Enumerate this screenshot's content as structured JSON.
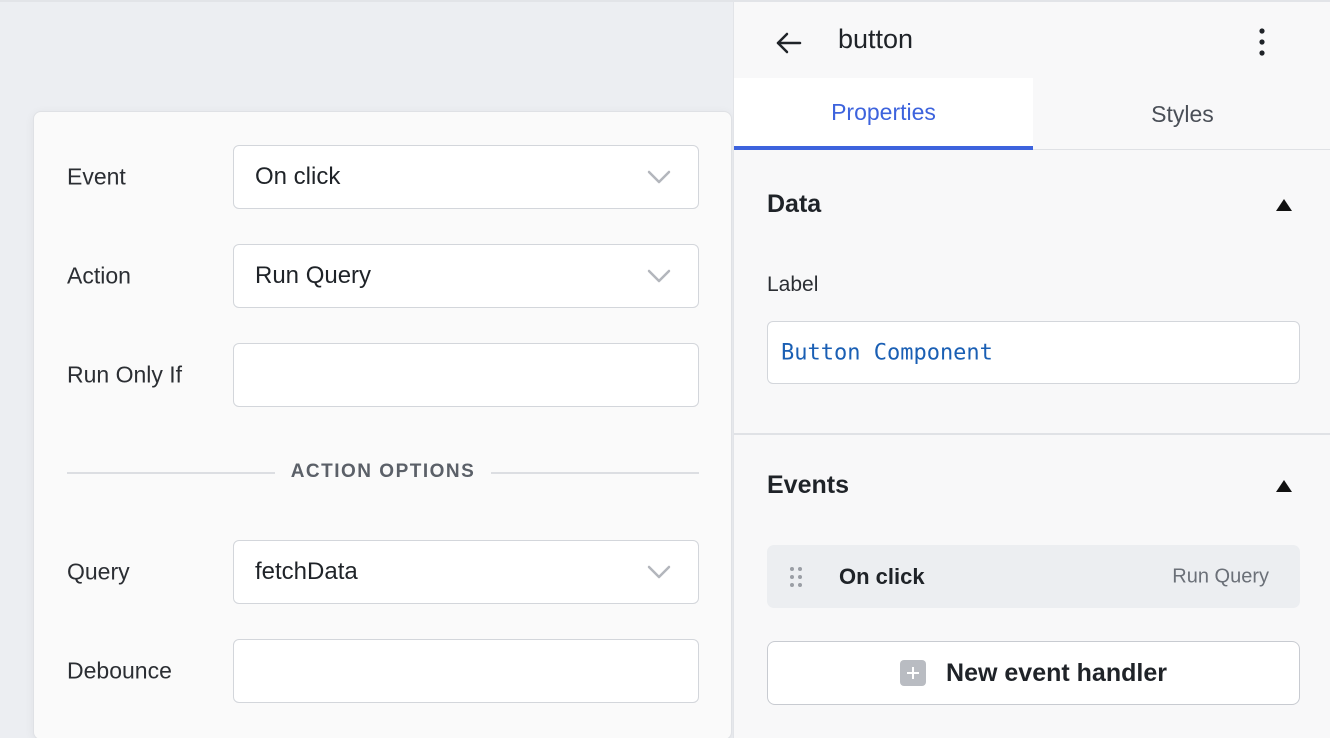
{
  "event_editor": {
    "event": {
      "label": "Event",
      "value": "On click"
    },
    "action": {
      "label": "Action",
      "value": "Run Query"
    },
    "run_only_if": {
      "label": "Run Only If",
      "value": ""
    },
    "action_options_heading": "ACTION OPTIONS",
    "query": {
      "label": "Query",
      "value": "fetchData"
    },
    "debounce": {
      "label": "Debounce",
      "value": ""
    }
  },
  "inspector": {
    "title": "button",
    "tabs": [
      {
        "label": "Properties",
        "active": true
      },
      {
        "label": "Styles",
        "active": false
      }
    ],
    "data_section": {
      "title": "Data",
      "label_field": {
        "label": "Label",
        "value": "Button Component"
      }
    },
    "events_section": {
      "title": "Events",
      "items": [
        {
          "event": "On click",
          "action": "Run Query"
        }
      ],
      "new_handler_label": "New event handler"
    }
  },
  "colors": {
    "accent": "#3d63dd",
    "code_text": "#1a5fb4",
    "canvas_bg": "#eceef2"
  },
  "icons": {
    "back": "back-arrow-icon",
    "more": "kebab-menu-icon",
    "collapse": "triangle-up-icon",
    "drag": "drag-handle-icon",
    "add": "plus-square-icon",
    "dropdown": "chevron-down-icon"
  }
}
